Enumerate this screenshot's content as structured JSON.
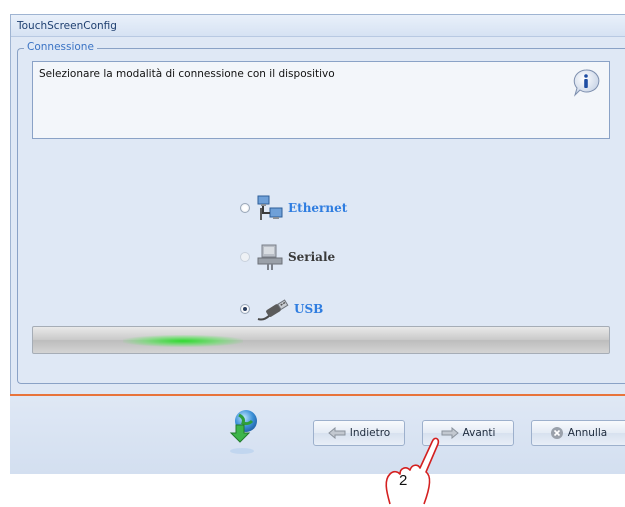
{
  "window": {
    "title": "TouchScreenConfig"
  },
  "group": {
    "legend": "Connessione"
  },
  "info": {
    "text": "Selezionare la modalità di connessione con il dispositivo",
    "icon": "info-icon"
  },
  "options": [
    {
      "label": "Ethernet",
      "icon": "network-computers-icon",
      "selected": false,
      "enabled": true
    },
    {
      "label": "Seriale",
      "icon": "serial-port-icon",
      "selected": false,
      "enabled": false
    },
    {
      "label": "USB",
      "icon": "usb-cable-icon",
      "selected": true,
      "enabled": true
    }
  ],
  "buttons": {
    "back": "Indietro",
    "next": "Avanti",
    "cancel": "Annulla"
  },
  "callout": {
    "number": "2"
  },
  "colors": {
    "accent_blue": "#2f7de0",
    "separator": "#e8743b",
    "progress_glow": "#28dc28"
  }
}
